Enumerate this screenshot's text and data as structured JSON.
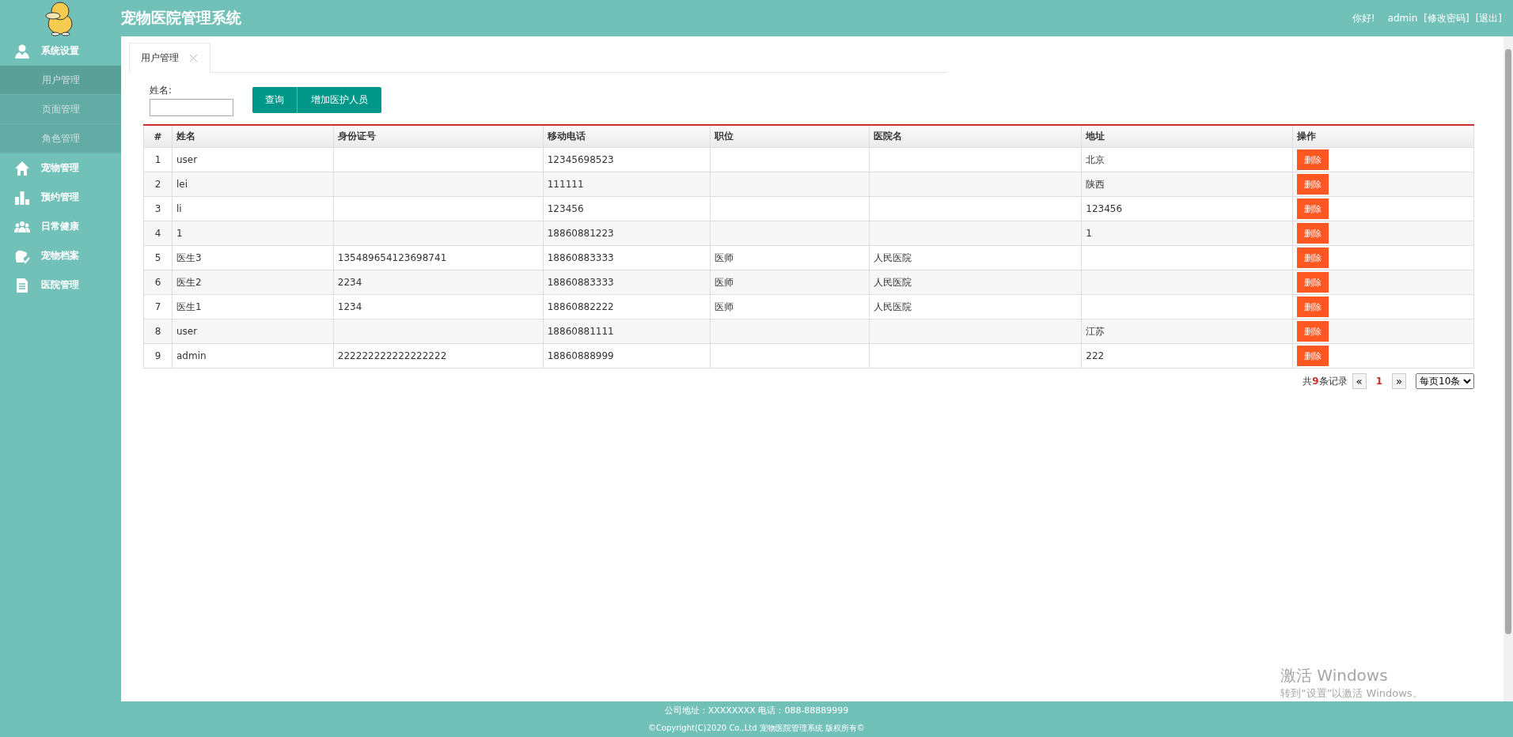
{
  "header": {
    "title": "宠物医院管理系统",
    "greeting": "你好!",
    "user": "admin",
    "links": [
      "[修改密码]",
      "[退出]"
    ]
  },
  "sidebar": {
    "items": [
      {
        "label": "系统设置",
        "children": [
          {
            "label": "用户管理",
            "selected": true
          },
          {
            "label": "页面管理",
            "selected": false
          },
          {
            "label": "角色管理",
            "selected": false
          }
        ]
      },
      {
        "label": "宠物管理"
      },
      {
        "label": "预约管理"
      },
      {
        "label": "日常健康"
      },
      {
        "label": "宠物档案"
      },
      {
        "label": "医院管理"
      }
    ]
  },
  "tabs": [
    {
      "label": "用户管理",
      "selected": true
    }
  ],
  "filter": {
    "label": "姓名:"
  },
  "buttons": [
    "查询",
    "增加医护人员"
  ],
  "table": {
    "columns": [
      "#",
      "姓名",
      "身份证号",
      "移动电话",
      "职位",
      "医院名",
      "地址",
      "操作"
    ],
    "rows": [
      {
        "cells": [
          "1",
          "user",
          "",
          "12345698523",
          "",
          "",
          "北京"
        ],
        "action": "删除"
      },
      {
        "cells": [
          "2",
          "lei",
          "",
          "111111",
          "",
          "",
          "陕西"
        ],
        "action": "删除"
      },
      {
        "cells": [
          "3",
          "li",
          "",
          "123456",
          "",
          "",
          "123456"
        ],
        "action": "删除"
      },
      {
        "cells": [
          "4",
          "1",
          "",
          "18860881223",
          "",
          "",
          "1"
        ],
        "action": "删除"
      },
      {
        "cells": [
          "5",
          "医生3",
          "135489654123698741",
          "18860883333",
          "医师",
          "人民医院",
          ""
        ],
        "action": "删除"
      },
      {
        "cells": [
          "6",
          "医生2",
          "2234",
          "18860883333",
          "医师",
          "人民医院",
          ""
        ],
        "action": "删除"
      },
      {
        "cells": [
          "7",
          "医生1",
          "1234",
          "18860882222",
          "医师",
          "人民医院",
          ""
        ],
        "action": "删除"
      },
      {
        "cells": [
          "8",
          "user",
          "",
          "18860881111",
          "",
          "",
          "江苏"
        ],
        "action": "删除"
      },
      {
        "cells": [
          "9",
          "admin",
          "222222222222222222",
          "18860888999",
          "",
          "",
          "222"
        ],
        "action": "删除"
      }
    ]
  },
  "pagination": {
    "summary": "共**9**条记录",
    "prev": "«",
    "current": "1",
    "next": "»",
    "page_size": "每页10条"
  },
  "footer": [
    "公司地址：XXXXXXXX 电话：088-88889999",
    "©Copyright(C)2020 Co.,Ltd 宠物医院管理系统 版权所有©"
  ],
  "os_notice": {
    "title": "激活 Windows",
    "subtitle": "转到“设置”以激活 Windows。"
  }
}
